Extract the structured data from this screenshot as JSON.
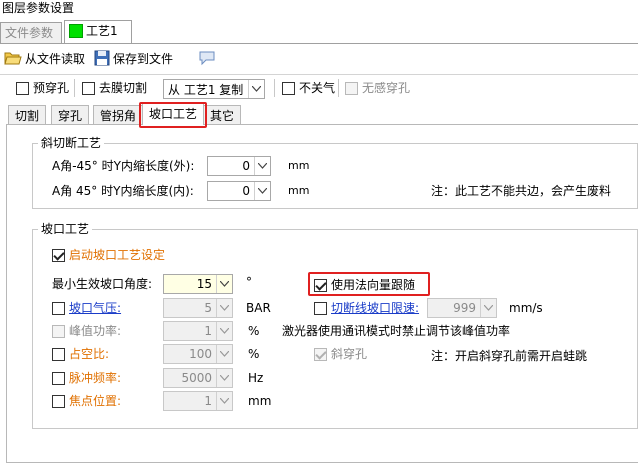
{
  "window": {
    "title": "图层参数设置"
  },
  "outer_tabs": {
    "file_params": "文件参数",
    "process": "工艺1",
    "process_color": "#00e000"
  },
  "toolbar": {
    "read_file": "从文件读取",
    "save_file": "保存到文件"
  },
  "options": {
    "pre_pierce": "预穿孔",
    "film_cut": "去膜切割",
    "copy_from": "从 工艺1 复制",
    "no_gas_off": "不关气",
    "no_sense_pierce": "无感穿孔"
  },
  "inner_tabs": [
    "切割",
    "穿孔",
    "管拐角",
    "坡口工艺",
    "其它"
  ],
  "oblique": {
    "title": "斜切断工艺",
    "a_minus45_label": "A角-45° 时Y内缩长度(外):",
    "a_minus45_value": "0",
    "a_minus45_unit": "mm",
    "a_45_label": "A角 45° 时Y内缩长度(内):",
    "a_45_value": "0",
    "a_45_unit": "mm",
    "note": "注：此工艺不能共边，会产生废料"
  },
  "bevel": {
    "title": "坡口工艺",
    "enable_label": "启动坡口工艺设定",
    "min_angle_label": "最小生效坡口角度:",
    "min_angle_value": "15",
    "min_angle_unit": "°",
    "normal_follow_label": "使用法向量跟随",
    "gas_pressure_label": "坡口气压:",
    "gas_pressure_value": "5",
    "gas_pressure_unit": "BAR",
    "cutoff_speed_label": "切断线坡口限速:",
    "cutoff_speed_value": "999",
    "cutoff_speed_unit": "mm/s",
    "peak_power_label": "峰值功率:",
    "peak_power_value": "1",
    "peak_power_unit": "%",
    "laser_note": "激光器使用通讯模式时禁止调节该峰值功率",
    "duty_label": "占空比:",
    "duty_value": "100",
    "duty_unit": "%",
    "oblique_pierce_label": "斜穿孔",
    "oblique_pierce_note": "注：开启斜穿孔前需开启蛙跳",
    "pulse_freq_label": "脉冲频率:",
    "pulse_freq_value": "5000",
    "pulse_freq_unit": "Hz",
    "focus_label": "焦点位置:",
    "focus_value": "1",
    "focus_unit": "mm"
  }
}
